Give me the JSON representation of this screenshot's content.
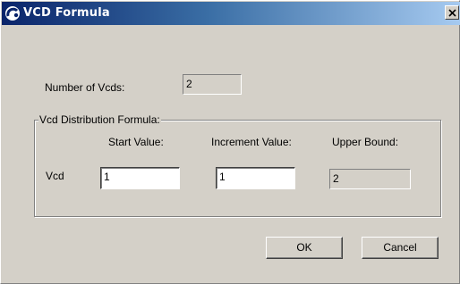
{
  "window": {
    "title": "VCD Formula"
  },
  "count": {
    "label": "Number of Vcds:",
    "value": "2"
  },
  "group": {
    "legend": "Vcd Distribution Formula:",
    "col_start": "Start Value:",
    "col_increment": "Increment Value:",
    "col_upper": "Upper Bound:",
    "row_label": "Vcd",
    "start_value": "1",
    "increment_value": "1",
    "upper_bound": "2"
  },
  "buttons": {
    "ok": "OK",
    "cancel": "Cancel"
  },
  "colors": {
    "titlebar_start": "#0a246a",
    "titlebar_end": "#a6caf0",
    "dialog_bg": "#d4d0c8"
  },
  "icons": {
    "title": "app-logo-icon",
    "close": "close-icon"
  }
}
